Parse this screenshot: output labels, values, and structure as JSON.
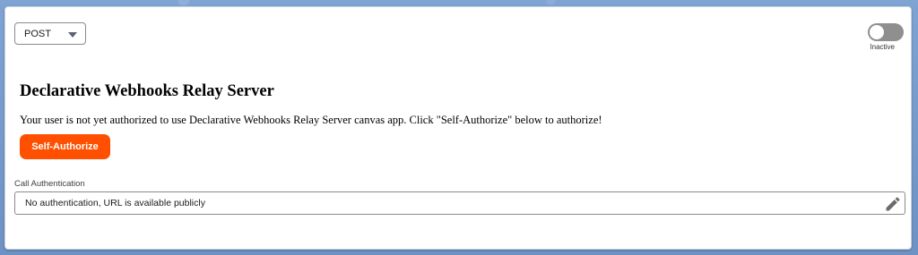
{
  "method_select": {
    "value": "POST"
  },
  "status_toggle": {
    "label": "Inactive",
    "active": false
  },
  "main": {
    "title": "Declarative Webhooks Relay Server",
    "message": "Your user is not yet authorized to use Declarative Webhooks Relay Server canvas app. Click \"Self-Authorize\" below to authorize!",
    "self_authorize_label": "Self-Authorize"
  },
  "call_authentication": {
    "label": "Call Authentication",
    "value": "No authentication, URL is available publicly",
    "edit_icon": "pencil-icon"
  },
  "colors": {
    "accent": "#fe5000",
    "background": "#7d9fcf",
    "toggle_off": "#8f8f8f"
  }
}
